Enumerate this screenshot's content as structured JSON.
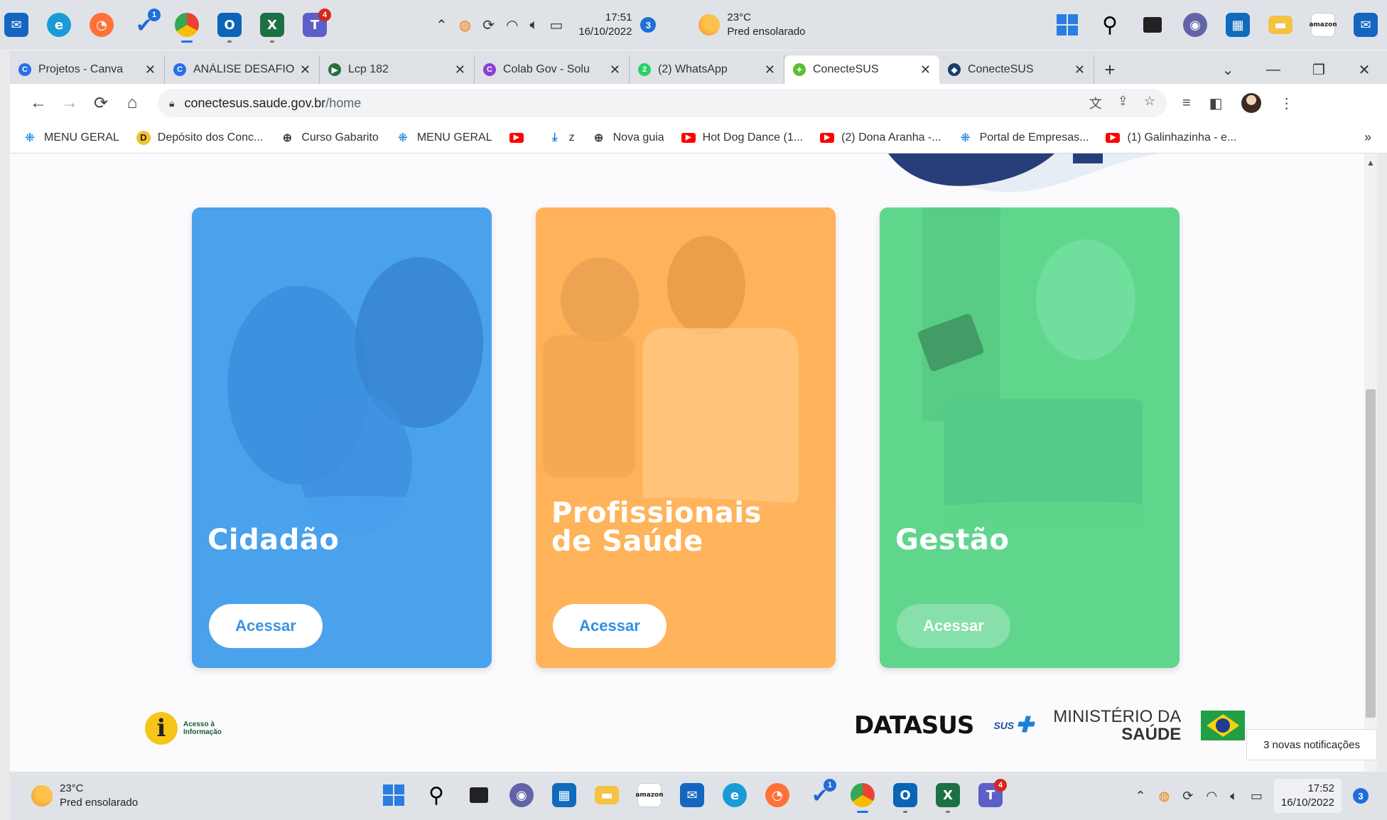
{
  "taskbar_top": {
    "icons": [
      "mail-icon",
      "edge-icon",
      "firefox-icon",
      "todo-icon",
      "chrome-icon",
      "outlook-icon",
      "excel-icon",
      "teams-icon"
    ],
    "todo_badge": "1",
    "teams_badge": "4",
    "time": "17:51",
    "date": "16/10/2022",
    "notif_count": "3",
    "weather_temp": "23°C",
    "weather_desc": "Pred ensolarado"
  },
  "tabs": [
    {
      "title": "Projetos - Canva",
      "favicon_color": "#2a6ee8",
      "favicon_text": "C"
    },
    {
      "title": "ANÁLISE DESAFIO",
      "favicon_color": "#2a6ee8",
      "favicon_text": "C"
    },
    {
      "title": "Lcp 182",
      "favicon_color": "#2c6e3f",
      "favicon_text": "▶"
    },
    {
      "title": "Colab Gov - Solu",
      "favicon_color": "#8b3fd9",
      "favicon_text": "C"
    },
    {
      "title": "(2) WhatsApp",
      "favicon_color": "#25d366",
      "favicon_text": "2"
    },
    {
      "title": "ConecteSUS",
      "favicon_color": "#5cbf2a",
      "favicon_text": "✦"
    },
    {
      "title": "ConecteSUS",
      "favicon_color": "#1a3c6e",
      "favicon_text": "◆"
    }
  ],
  "address": {
    "domain": "conectesus.saude.gov.br",
    "path": "/home"
  },
  "bookmarks": [
    {
      "label": "MENU GERAL",
      "icon": "ms"
    },
    {
      "label": "Depósito dos Conc...",
      "icon": "dsign"
    },
    {
      "label": "Curso Gabarito",
      "icon": "globe"
    },
    {
      "label": "MENU GERAL",
      "icon": "ms"
    },
    {
      "label": "",
      "icon": "yt"
    },
    {
      "label": "z",
      "icon": "dl"
    },
    {
      "label": "Nova guia",
      "icon": "globe"
    },
    {
      "label": "Hot Dog Dance (1...",
      "icon": "yt"
    },
    {
      "label": "(2) Dona Aranha -...",
      "icon": "yt"
    },
    {
      "label": "Portal de Empresas...",
      "icon": "ms"
    },
    {
      "label": "(1) Galinhazinha - e...",
      "icon": "yt"
    }
  ],
  "cards": [
    {
      "title_lines": [
        "Cidadão"
      ],
      "button": "Acessar",
      "color": "#4aa1ec",
      "button_color": "#3b93e3"
    },
    {
      "title_lines": [
        "Profissionais",
        "de Saúde"
      ],
      "button": "Acessar",
      "color": "#ffb25a",
      "button_color": "#2f8ee6"
    },
    {
      "title_lines": [
        "Gestão"
      ],
      "button": "Acessar",
      "color": "#5fd68c",
      "button_color": "#ffffff"
    }
  ],
  "footer": {
    "info_line1": "Acesso à",
    "info_line2": "Informação",
    "datasus": "DATASUS",
    "sus": "SUS",
    "ministerio_line1": "MINISTÉRIO DA",
    "ministerio_line2": "SAÚDE"
  },
  "notification_toast": "3 novas notificações",
  "taskbar_bottom": {
    "weather_temp": "23°C",
    "weather_desc": "Pred ensolarado",
    "time": "17:52",
    "date": "16/10/2022",
    "notif_count": "3",
    "todo_badge": "1",
    "teams_badge": "4"
  }
}
